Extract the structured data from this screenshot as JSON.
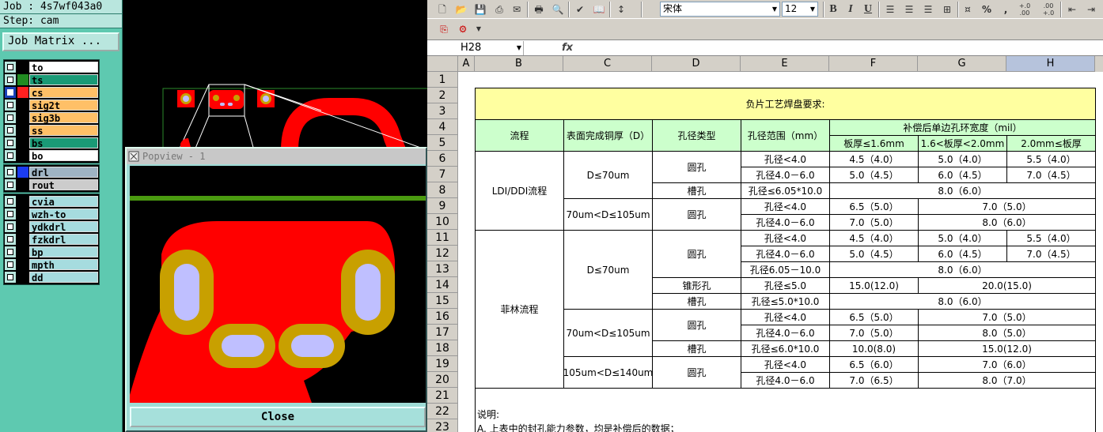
{
  "genesis": {
    "job_label": "Job : 4s7wf043a0",
    "step_label": "Step: cam",
    "matrix_button": "Job Matrix ...",
    "layer_groups": [
      [
        {
          "name": "to",
          "color": "#ffffff"
        },
        {
          "name": "ts",
          "color": "#1a9a76"
        },
        {
          "name": "cs",
          "color": "#ffc067",
          "selected": true
        },
        {
          "name": "sig2t",
          "color": "#ffc067"
        },
        {
          "name": "sig3b",
          "color": "#ffc067"
        },
        {
          "name": "ss",
          "color": "#ffc067"
        },
        {
          "name": "bs",
          "color": "#1a9a76"
        },
        {
          "name": "bo",
          "color": "#ffffff"
        }
      ],
      [
        {
          "name": "drl",
          "color": "#9fb4c4"
        },
        {
          "name": "rout",
          "color": "#cccccc"
        }
      ],
      [
        {
          "name": "cvia",
          "color": "#a6dcdf"
        },
        {
          "name": "wzh-to",
          "color": "#a6dcdf"
        },
        {
          "name": "ydkdrl",
          "color": "#a6dcdf"
        },
        {
          "name": "fzkdrl",
          "color": "#a6dcdf"
        },
        {
          "name": "bp",
          "color": "#a6dcdf"
        },
        {
          "name": "mpth",
          "color": "#a6dcdf"
        },
        {
          "name": "dd",
          "color": "#a6dcdf"
        }
      ]
    ],
    "swatch_colors": {
      "to": "#000000",
      "ts": "#228c22",
      "cs": "#ff2020",
      "sig2t": "#000000",
      "sig3b": "#000000",
      "ss": "#000000",
      "bs": "#000000",
      "bo": "#000000",
      "drl": "#1c3cf0",
      "rout": "#000000",
      "cvia": "#000000",
      "wzh-to": "#000000",
      "ydkdrl": "#000000",
      "fzkdrl": "#000000",
      "bp": "#000000",
      "mpth": "#000000",
      "dd": "#000000"
    },
    "popview": {
      "title": "Popview - 1",
      "close_label": "Close"
    },
    "colors": {
      "copper": "#ff0000",
      "pad_ring": "#c8a000",
      "hole": "#bfbfff",
      "trace_green": "#4a9a10"
    }
  },
  "excel": {
    "toolbar": {
      "font_name": "宋体",
      "font_size": "12",
      "bold": "B",
      "italic": "I",
      "underline": "U",
      "percent": "%",
      "comma": ",",
      "inc_decimal": "+.0 .00",
      "dec_decimal": ".00 +.0"
    },
    "name_box": "H28",
    "fx_label": "fx",
    "col_headers": [
      "A",
      "B",
      "C",
      "D",
      "E",
      "F",
      "G",
      "H"
    ],
    "row_headers": [
      "1",
      "2",
      "3",
      "4",
      "5",
      "6",
      "7",
      "8",
      "9",
      "10",
      "11",
      "12",
      "13",
      "14",
      "15",
      "16",
      "17",
      "18",
      "19",
      "20",
      "21",
      "22",
      "23"
    ],
    "table": {
      "title": "负片工艺焊盘要求:",
      "h_process": "流程",
      "h_copper": "表面完成铜厚（D）",
      "h_hole_type": "孔径类型",
      "h_hole_range": "孔径范围（mm）",
      "h_comp": "补偿后单边孔环宽度（mil）",
      "h_t1": "板厚≤1.6mm",
      "h_t2": "1.6<板厚<2.0mm",
      "h_t3": "2.0mm≤板厚",
      "ldi": "LDI/DDI流程",
      "filin": "菲林流程",
      "cu70": "D≤70um",
      "cu70_105": "70um<D≤105um",
      "cu105_140": "105um<D≤140um",
      "round": "圆孔",
      "slot": "槽孔",
      "cone": "锥形孔",
      "lt4": "孔径<4.0",
      "r4_6": "孔径4.0－6.0",
      "s605": "孔径≤6.05*10.0",
      "r605_10": "孔径6.05－10.0",
      "le5": "孔径≤5.0",
      "s5": "孔径≤5.0*10.0",
      "s6": "孔径≤6.0*10.0",
      "v_45_40": "4.5（4.0）",
      "v_50_40": "5.0（4.0）",
      "v_55_40": "5.5（4.0）",
      "v_50_45": "5.0（4.5）",
      "v_60_45": "6.0（4.5）",
      "v_70_45": "7.0（4.5）",
      "v_80_60": "8.0（6.0）",
      "v_65_50": "6.5（5.0）",
      "v_70_50": "7.0（5.0）",
      "v_150_120": "15.0(12.0)",
      "v_200_150": "20.0(15.0)",
      "v_80_50": "8.0（5.0）",
      "v_100_80": "10.0(8.0)",
      "v_150_120b": "15.0(12.0)",
      "v_65_60": "6.5（6.0）",
      "v_70_60": "7.0（6.0）",
      "v_70_65": "7.0（6.5）",
      "v_80_70": "8.0（7.0）",
      "note1": "说明:",
      "note2": "A. 上表中的封孔能力参数，均是补偿后的数据；"
    }
  }
}
